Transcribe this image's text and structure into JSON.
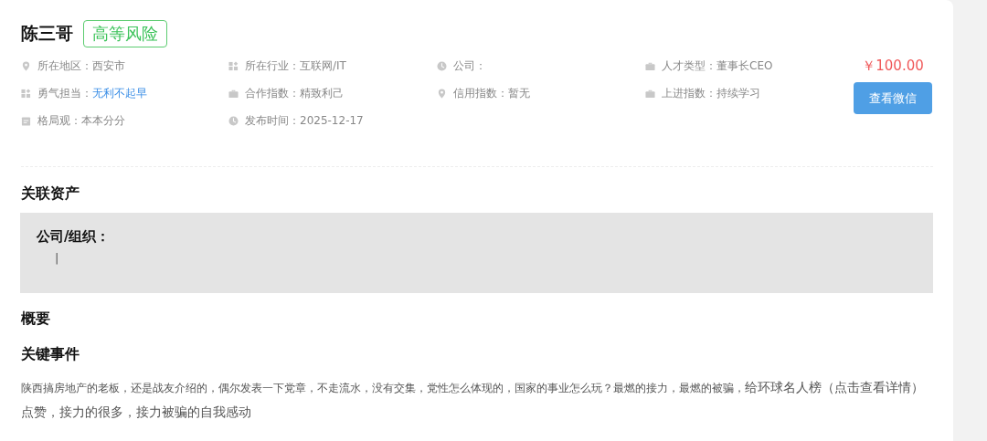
{
  "profile": {
    "name": "陈三哥",
    "risk_tag": "高等风险"
  },
  "info": [
    {
      "kind": "pin",
      "label": "所在地区：",
      "value": "西安市",
      "link": false
    },
    {
      "kind": "grid",
      "label": "所在行业：",
      "value": "互联网/IT",
      "link": false
    },
    {
      "kind": "clock",
      "label": "公司："
    },
    {
      "kind": "case",
      "label": "人才类型：",
      "value": "董事长CEO",
      "link": false
    },
    {
      "kind": "grid",
      "label": "勇气担当：",
      "value": "无利不起早",
      "link": true
    },
    {
      "kind": "case",
      "label": "合作指数：",
      "value": "精致利己",
      "link": false
    },
    {
      "kind": "pin",
      "label": "信用指数：",
      "value": "暂无",
      "link": false
    },
    {
      "kind": "case",
      "label": "上进指数：",
      "value": "持续学习",
      "link": false
    },
    {
      "kind": "calendar",
      "label": "格局观：",
      "value": "本本分分",
      "link": false
    },
    {
      "kind": "clock",
      "label": "发布时间：",
      "value": "2025-12-17",
      "link": false
    }
  ],
  "price": "￥100.00",
  "wechat_button": "查看微信",
  "assets": {
    "title": "关联资产",
    "label": "公司/组织：",
    "value": "|"
  },
  "summary": {
    "title": "概要"
  },
  "events": {
    "title": "关键事件",
    "text": "陕西搞房地产的老板，还是战友介绍的，偶尔发表一下党章，不走流水，没有交集，党性怎么体现的，国家的事业怎么玩？最燃的接力，最燃的被骗，",
    "text_large": "给环球名人榜（点击查看详情）点赞，接力的很多，接力被骗的自我感动"
  }
}
